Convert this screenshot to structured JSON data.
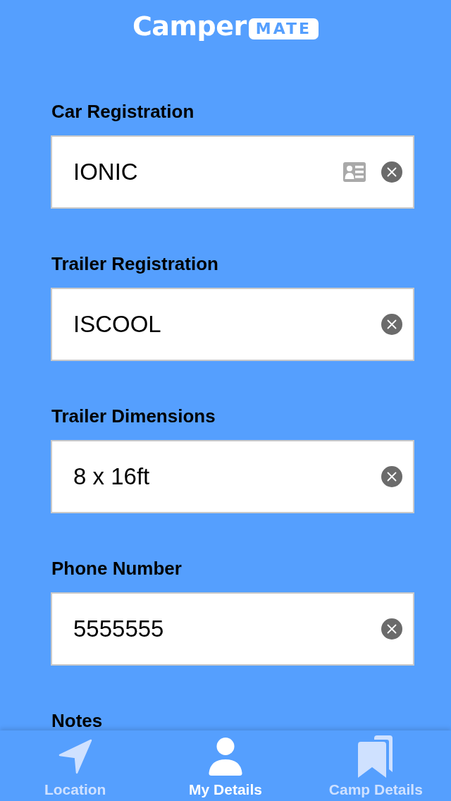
{
  "logo": {
    "word": "Camper",
    "badge": "MATE"
  },
  "fields": [
    {
      "label": "Car Registration",
      "value": "IONIC",
      "kind": "card"
    },
    {
      "label": "Trailer Registration",
      "value": "ISCOOL",
      "kind": "plain"
    },
    {
      "label": "Trailer Dimensions",
      "value": "8 x 16ft",
      "kind": "plain"
    },
    {
      "label": "Phone Number",
      "value": "5555555",
      "kind": "plain"
    }
  ],
  "notes": {
    "label": "Notes"
  },
  "tabs": [
    {
      "label": "Location",
      "selected": false
    },
    {
      "label": "My Details",
      "selected": true
    },
    {
      "label": "Camp Details",
      "selected": false
    }
  ]
}
